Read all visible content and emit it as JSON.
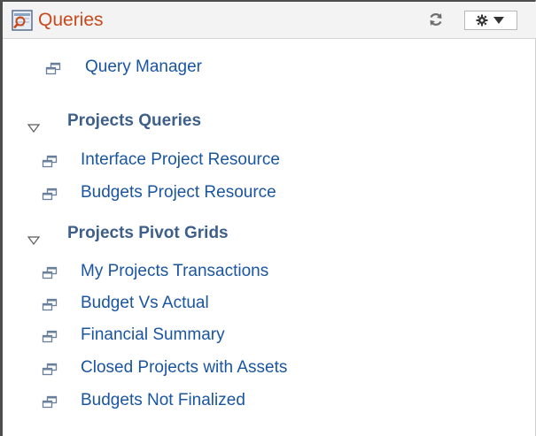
{
  "pagelet": {
    "title": "Queries",
    "icon": "query-icon",
    "refresh_icon": "refresh-icon",
    "options_icon": "gear-icon",
    "options_arrow_icon": "chevron-down-icon",
    "colors": {
      "title": "#c8491c",
      "link": "#1a55a0",
      "group": "#3e5f8a"
    }
  },
  "top_links": [
    {
      "label": "Query Manager",
      "icon": "link-icon"
    }
  ],
  "groups": [
    {
      "label": "Projects Queries",
      "icon": "collapse-triangle-icon",
      "items": [
        {
          "label": "Interface Project Resource",
          "icon": "link-icon"
        },
        {
          "label": "Budgets Project Resource",
          "icon": "link-icon"
        }
      ]
    },
    {
      "label": "Projects Pivot Grids",
      "icon": "collapse-triangle-icon",
      "items": [
        {
          "label": "My Projects Transactions",
          "icon": "link-icon"
        },
        {
          "label": "Budget Vs Actual",
          "icon": "link-icon"
        },
        {
          "label": "Financial Summary",
          "icon": "link-icon"
        },
        {
          "label": "Closed Projects with Assets",
          "icon": "link-icon"
        },
        {
          "label": "Budgets Not Finalized",
          "icon": "link-icon"
        }
      ]
    }
  ]
}
